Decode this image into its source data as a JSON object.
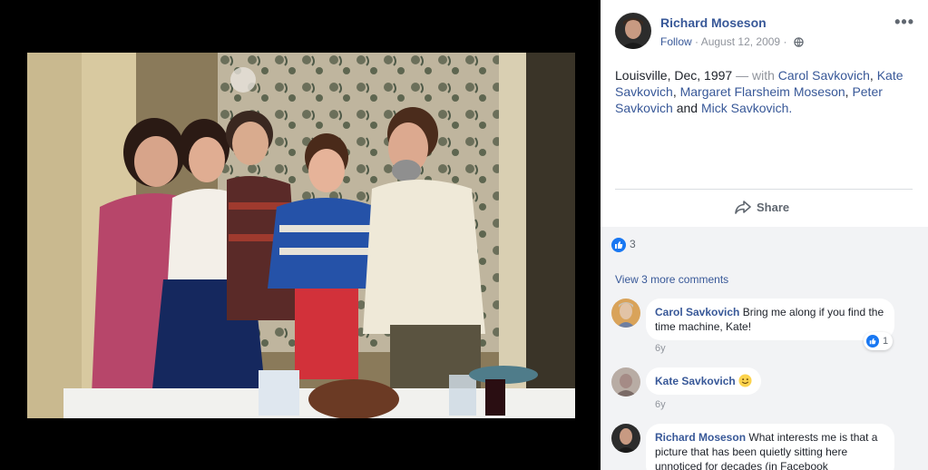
{
  "post": {
    "author": "Richard Moseson",
    "follow": "Follow",
    "separator": " · ",
    "date": "August 12, 2009",
    "privacy_icon": "globe-icon",
    "more_icon": "more-dots-icon",
    "more_label": "•••",
    "caption": {
      "text": "Louisville, Dec, 1997",
      "with": " — with ",
      "tags": [
        "Carol Savkovich",
        "Kate Savkovich",
        "Margaret Flarsheim Moseson",
        "Peter Savkovich",
        "Mick Savkovich"
      ],
      "sep1": ", ",
      "and": " and ",
      "end": "."
    },
    "share_label": "Share",
    "share_icon": "share-arrow-icon",
    "reaction_count": "3",
    "view_more": "View 3 more comments"
  },
  "comments": [
    {
      "author": "Carol Savkovich",
      "text": " Bring me along if you find the time machine, Kate!",
      "time": "6y",
      "reaction_count": "1"
    },
    {
      "author": "Kate Savkovich",
      "text": "",
      "emoji": "smile-emoji-icon",
      "time": "6y"
    },
    {
      "author": "Richard Moseson",
      "text": " What interests me is that a picture that has been quietly sitting here unnoticed for decades (in Facebook"
    }
  ],
  "colors": {
    "link": "#385898",
    "muted": "#90949c",
    "like_blue": "#1877f2",
    "panel_bg": "#ffffff",
    "comments_bg": "#f2f3f5"
  }
}
